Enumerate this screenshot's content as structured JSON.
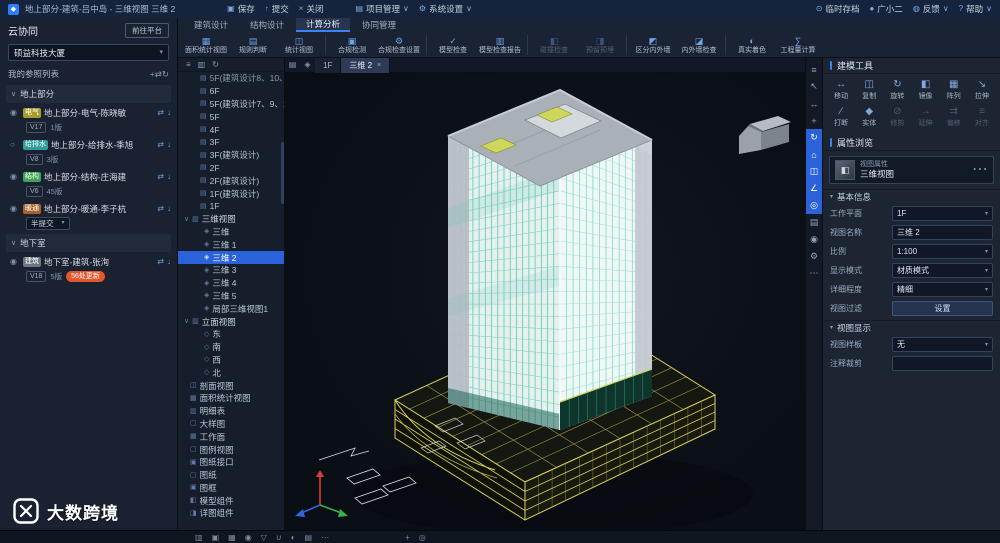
{
  "meta": {
    "watermark": "大数跨境"
  },
  "colors": {
    "accent": "#3b82f6",
    "titlebar": "#15243c",
    "panel": "#1a2130",
    "selected": "#2a62d9",
    "update_badge": "#e2572b",
    "tower_teal": "#57b9ae",
    "podium_yellow": "#d8cf5e"
  },
  "icon_glyphs": {
    "app-logo": "◆",
    "save": "▣",
    "commit": "↑",
    "close-doc": "×",
    "undo": "↺",
    "redo": "↻",
    "project": "▤",
    "settings": "⚙",
    "archive": "⊙",
    "user": "●",
    "feedback": "◍",
    "help": "?",
    "caret": "∨",
    "chevron-down": "▾",
    "chevron-right": "▸",
    "plus": "+",
    "link": "⇄",
    "refresh": "↻",
    "eye": "◉",
    "eye-off": "○",
    "download": "↓",
    "more": "⋯",
    "search": "◎",
    "area-stats": "▦",
    "rule-check": "▤",
    "stats-view": "◫",
    "compliance": "▣",
    "compliance-set": "⚙",
    "model-check": "✓",
    "model-report": "▥",
    "clash": "◧",
    "embed": "◨",
    "wall-inout": "◩",
    "wall-check": "◪",
    "shading": "◐",
    "quantity": "∑",
    "folder": "▥",
    "floor": "▤",
    "view3d": "◈",
    "elevation": "◇",
    "section-view": "◫",
    "sheet": "▢",
    "frame": "▣",
    "component": "◧",
    "detail": "◨",
    "workplane": "▦",
    "schedule": "▥",
    "area-view": "▦",
    "move": "↔",
    "copy": "◫",
    "rotate": "↻",
    "mirror": "◧",
    "array": "▦",
    "stretch": "↘",
    "break": "∕",
    "solid": "◆",
    "trim": "⊘",
    "extend": "→",
    "offset": "⇉",
    "align": "≡",
    "menu": "≡",
    "select": "↖",
    "pan": "+",
    "zoom": "◎",
    "orbit": "↻",
    "home": "⌂",
    "measure": "∠",
    "layers": "▤",
    "camera": "◉",
    "grid": "▦",
    "filter": "▽",
    "magnet": "∪",
    "sun": "◐",
    "crosshair": "+",
    "info": "◎",
    "cube": "◧"
  },
  "titlebar": {
    "title": "地上部分-建筑-吕中岛 - 三维视图 三维 2",
    "center_actions": [
      {
        "label": "保存",
        "icon": "save"
      },
      {
        "label": "提交",
        "icon": "commit"
      },
      {
        "label": "关闭",
        "icon": "close-doc"
      }
    ],
    "menus": [
      {
        "label": "项目管理",
        "icon": "project"
      },
      {
        "label": "系统设置",
        "icon": "settings"
      }
    ],
    "right_items": [
      {
        "label": "临时存档",
        "icon": "archive"
      },
      {
        "label": "广小二",
        "icon": "user"
      },
      {
        "label": "反馈",
        "icon": "feedback",
        "caret": true
      },
      {
        "label": "帮助",
        "icon": "help",
        "caret": true
      }
    ]
  },
  "ribbon": {
    "tabs": [
      {
        "label": "建筑设计",
        "active": false
      },
      {
        "label": "结构设计",
        "active": false
      },
      {
        "label": "计算分析",
        "active": true
      },
      {
        "label": "协同管理",
        "active": false
      }
    ],
    "buttons": [
      {
        "label": "面积统计视图",
        "icon": "area-stats",
        "group": 1
      },
      {
        "label": "规则判断",
        "icon": "rule-check",
        "group": 1
      },
      {
        "label": "统计视图",
        "icon": "stats-view",
        "group": 1
      },
      {
        "label": "合规检测",
        "icon": "compliance",
        "group": 2
      },
      {
        "label": "合规检查设置",
        "icon": "compliance-set",
        "group": 2
      },
      {
        "label": "模型检查",
        "icon": "model-check",
        "group": 3
      },
      {
        "label": "模型检查报告",
        "icon": "model-report",
        "group": 3
      },
      {
        "label": "碰撞检查",
        "icon": "clash",
        "group": 4,
        "disabled": true
      },
      {
        "label": "预留预埋",
        "icon": "embed",
        "group": 4,
        "disabled": true
      },
      {
        "label": "区分内外墙",
        "icon": "wall-inout",
        "group": 5
      },
      {
        "label": "内外墙检查",
        "icon": "wall-check",
        "group": 5
      },
      {
        "label": "真实着色",
        "icon": "shading",
        "group": 6
      },
      {
        "label": "工程量计算",
        "icon": "quantity",
        "group": 6
      }
    ]
  },
  "cloud_panel": {
    "title": "云协同",
    "platform_button": "前往平台",
    "project_name": "硕益科技大厦",
    "list_header": "我的参照列表",
    "header_icons": [
      "plus",
      "link",
      "refresh"
    ],
    "groups": [
      {
        "label": "地上部分",
        "items": [
          {
            "discipline": "电气",
            "chip_color": "#a99a2e",
            "name": "地上部分-电气-陈晓敏",
            "version": "V17",
            "count": "1版",
            "visible": true
          },
          {
            "discipline": "给排水",
            "chip_color": "#2f9e9a",
            "name": "地上部分-给排水-季旭",
            "version": "V8",
            "count": "3版",
            "visible": false
          },
          {
            "discipline": "结构",
            "chip_color": "#3fa457",
            "name": "地上部分-结构-庄海建",
            "version": "V6",
            "count": "45版",
            "visible": true
          },
          {
            "discipline": "暖通",
            "chip_color": "#a8622d",
            "name": "地上部分-暖通-李子杭",
            "state_select": "半提交",
            "visible": true
          }
        ]
      },
      {
        "label": "地下室",
        "items": [
          {
            "discipline": "建筑",
            "chip_color": "#6f7680",
            "name": "地下室-建筑-张洵",
            "version": "V18",
            "count": "5版",
            "badge": "56处更新",
            "visible": true
          }
        ]
      }
    ]
  },
  "view_tree": {
    "toolbar": [
      "menu",
      "folder",
      "refresh"
    ],
    "items": [
      {
        "label": "5F(建筑设计8、10、…",
        "type": "floor",
        "muted": true
      },
      {
        "label": "6F",
        "type": "floor"
      },
      {
        "label": "5F(建筑设计7、9、1…",
        "type": "floor"
      },
      {
        "label": "5F",
        "type": "floor"
      },
      {
        "label": "4F",
        "type": "floor"
      },
      {
        "label": "3F",
        "type": "floor"
      },
      {
        "label": "3F(建筑设计)",
        "type": "floor"
      },
      {
        "label": "2F",
        "type": "floor"
      },
      {
        "label": "2F(建筑设计)",
        "type": "floor"
      },
      {
        "label": "1F(建筑设计)",
        "type": "floor"
      },
      {
        "label": "1F",
        "type": "floor"
      },
      {
        "label": "三维视图",
        "type": "section"
      },
      {
        "label": "三维",
        "type": "view"
      },
      {
        "label": "三维 1",
        "type": "view"
      },
      {
        "label": "三维 2",
        "type": "view",
        "selected": true
      },
      {
        "label": "三维 3",
        "type": "view"
      },
      {
        "label": "三维 4",
        "type": "view"
      },
      {
        "label": "三维 5",
        "type": "view"
      },
      {
        "label": "局部三维视图1",
        "type": "view"
      },
      {
        "label": "立面视图",
        "type": "section"
      },
      {
        "label": "东",
        "type": "view",
        "icon": "elevation"
      },
      {
        "label": "南",
        "type": "view",
        "icon": "elevation"
      },
      {
        "label": "西",
        "type": "view",
        "icon": "elevation"
      },
      {
        "label": "北",
        "type": "view",
        "icon": "elevation"
      },
      {
        "label": "剖面视图",
        "type": "leaf",
        "icon": "section-view"
      },
      {
        "label": "面积统计视图",
        "type": "leaf",
        "icon": "area-view"
      },
      {
        "label": "明细表",
        "type": "leaf",
        "icon": "schedule"
      },
      {
        "label": "大样图",
        "type": "leaf",
        "icon": "sheet"
      },
      {
        "label": "工作面",
        "type": "leaf",
        "icon": "workplane"
      },
      {
        "label": "图例视图",
        "type": "leaf",
        "icon": "sheet"
      },
      {
        "label": "图纸接口",
        "type": "leaf",
        "icon": "frame"
      },
      {
        "label": "图纸",
        "type": "leaf",
        "icon": "sheet"
      },
      {
        "label": "图框",
        "type": "leaf",
        "icon": "frame"
      },
      {
        "label": "模型组件",
        "type": "leaf",
        "icon": "component"
      },
      {
        "label": "详图组件",
        "type": "leaf",
        "icon": "detail"
      }
    ]
  },
  "viewport": {
    "tab_icons": [
      {
        "icon": "layers"
      },
      {
        "icon": "view3d"
      }
    ],
    "tabs": [
      {
        "label": "1F",
        "active": false
      },
      {
        "label": "三维 2",
        "active": true
      }
    ]
  },
  "view_toolbar": [
    {
      "icon": "menu"
    },
    {
      "icon": "select"
    },
    {
      "icon": "move"
    },
    {
      "icon": "pan"
    },
    {
      "icon": "orbit",
      "active": true
    },
    {
      "icon": "home",
      "active": true
    },
    {
      "icon": "section-view",
      "active": true
    },
    {
      "icon": "measure",
      "active": true
    },
    {
      "icon": "zoom",
      "active": true
    },
    {
      "icon": "layers"
    },
    {
      "icon": "camera"
    },
    {
      "icon": "settings"
    },
    {
      "icon": "more"
    }
  ],
  "modeling_tools": {
    "title": "建模工具",
    "tools": [
      {
        "label": "移动",
        "icon": "move"
      },
      {
        "label": "复制",
        "icon": "copy"
      },
      {
        "label": "旋转",
        "icon": "rotate"
      },
      {
        "label": "镜像",
        "icon": "mirror"
      },
      {
        "label": "阵列",
        "icon": "array"
      },
      {
        "label": "拉伸",
        "icon": "stretch"
      },
      {
        "label": "打断",
        "icon": "break"
      },
      {
        "label": "实体",
        "icon": "solid"
      },
      {
        "label": "修剪",
        "icon": "trim",
        "disabled": true
      },
      {
        "label": "延伸",
        "icon": "extend",
        "disabled": true
      },
      {
        "label": "偏移",
        "icon": "offset",
        "disabled": true
      },
      {
        "label": "对齐",
        "icon": "align",
        "disabled": true
      }
    ]
  },
  "properties": {
    "title": "属性浏览",
    "selection": {
      "category": "视图属性",
      "name": "三维视图"
    },
    "sections": [
      {
        "title": "基本信息",
        "rows": [
          {
            "label": "工作平面",
            "value": "1F",
            "control": "select"
          },
          {
            "label": "视图名称",
            "value": "三维 2",
            "control": "input"
          },
          {
            "label": "比例",
            "value": "1:100",
            "control": "select"
          },
          {
            "label": "显示模式",
            "value": "材质模式",
            "control": "select"
          },
          {
            "label": "详细程度",
            "value": "精细",
            "control": "select"
          },
          {
            "label": "视图过滤",
            "value": "设置",
            "control": "button"
          }
        ]
      },
      {
        "title": "视图显示",
        "rows": [
          {
            "label": "视图样板",
            "value": "无",
            "control": "select"
          },
          {
            "label": "注释裁剪",
            "value": "",
            "control": "input"
          }
        ]
      }
    ]
  },
  "status_bar": {
    "left": [
      {
        "icon": "folder"
      },
      {
        "icon": "save"
      },
      {
        "icon": "grid"
      },
      {
        "icon": "eye"
      },
      {
        "icon": "filter"
      },
      {
        "icon": "magnet"
      },
      {
        "icon": "sun"
      },
      {
        "icon": "layers"
      },
      {
        "icon": "more"
      }
    ],
    "mid": [
      {
        "icon": "crosshair"
      },
      {
        "icon": "info"
      }
    ]
  },
  "scene": {
    "floors": 27,
    "left_mullions": 18,
    "right_mullions": 14,
    "left_mullion_color": "#57b9ae",
    "left_floor_color": "#84cec5",
    "right_mullion_color": "#79cfc5",
    "right_floor_color": "#a5ded6",
    "podium_line_color": "#d8cf5e",
    "podium_line_dim": "#a09a48",
    "storefront_mullion": "#2e8671",
    "glass_left": "#e4f2ee",
    "glass_right": "#eef9f5"
  }
}
